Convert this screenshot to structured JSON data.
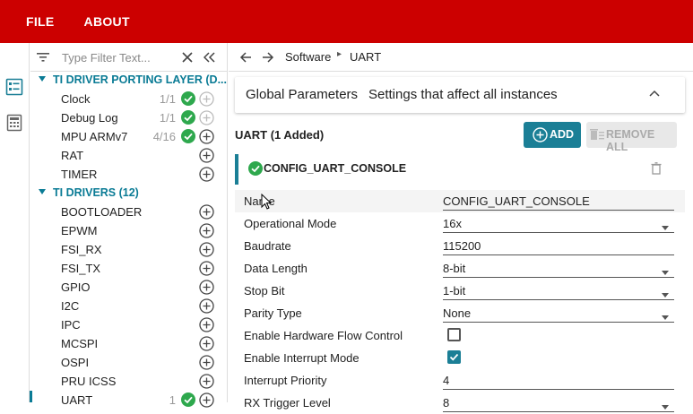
{
  "menu": {
    "file": "FILE",
    "about": "ABOUT"
  },
  "filter": {
    "placeholder": "Type Filter Text..."
  },
  "tree": {
    "driver_porting": {
      "label": "TI DRIVER PORTING LAYER (D...",
      "items": [
        {
          "label": "Clock",
          "count": "1/1",
          "ok": true,
          "plus_enabled": false
        },
        {
          "label": "Debug Log",
          "count": "1/1",
          "ok": true,
          "plus_enabled": false
        },
        {
          "label": "MPU ARMv7",
          "count": "4/16",
          "ok": true,
          "plus_enabled": true
        },
        {
          "label": "RAT",
          "count": "",
          "ok": false,
          "plus_enabled": true
        },
        {
          "label": "TIMER",
          "count": "",
          "ok": false,
          "plus_enabled": true
        }
      ]
    },
    "drivers": {
      "label": "TI DRIVERS (12)",
      "items": [
        {
          "label": "BOOTLOADER"
        },
        {
          "label": "EPWM"
        },
        {
          "label": "FSI_RX"
        },
        {
          "label": "FSI_TX"
        },
        {
          "label": "GPIO"
        },
        {
          "label": "I2C"
        },
        {
          "label": "IPC"
        },
        {
          "label": "MCSPI"
        },
        {
          "label": "OSPI"
        },
        {
          "label": "PRU ICSS"
        },
        {
          "label": "UART",
          "count": "1"
        }
      ]
    }
  },
  "breadcrumb": {
    "part1": "Software",
    "part2": "UART"
  },
  "global_params": {
    "title": "Global Parameters",
    "desc": "Settings that affect all instances"
  },
  "module": {
    "title": "UART (1 Added)",
    "add_label": "ADD",
    "remove_all_label": "REMOVE ALL",
    "instance_name": "CONFIG_UART_CONSOLE"
  },
  "properties": [
    {
      "label": "Name",
      "value": "CONFIG_UART_CONSOLE",
      "type": "text"
    },
    {
      "label": "Operational Mode",
      "value": "16x",
      "type": "select"
    },
    {
      "label": "Baudrate",
      "value": "115200",
      "type": "text"
    },
    {
      "label": "Data Length",
      "value": "8-bit",
      "type": "select"
    },
    {
      "label": "Stop Bit",
      "value": "1-bit",
      "type": "select"
    },
    {
      "label": "Parity Type",
      "value": "None",
      "type": "select"
    },
    {
      "label": "Enable Hardware Flow Control",
      "value": "",
      "type": "checkbox",
      "checked": false
    },
    {
      "label": "Enable Interrupt Mode",
      "value": "",
      "type": "checkbox",
      "checked": true
    },
    {
      "label": "Interrupt Priority",
      "value": "4",
      "type": "text"
    },
    {
      "label": "RX Trigger Level",
      "value": "8",
      "type": "select"
    }
  ],
  "colors": {
    "brand_red": "#cc0000",
    "teal": "#1b7f96",
    "ok_green": "#2ea84d"
  }
}
